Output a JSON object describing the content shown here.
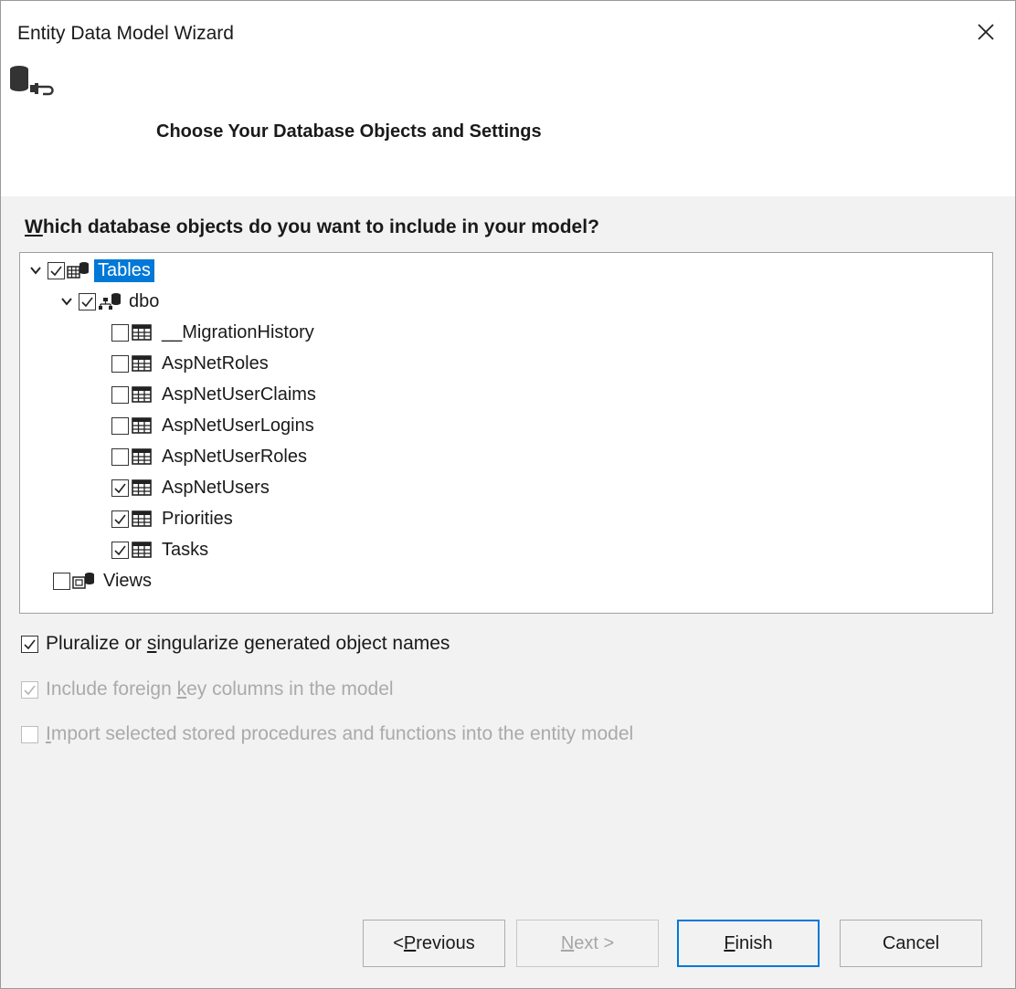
{
  "window": {
    "title": "Entity Data Model Wizard",
    "header": "Choose Your Database Objects and Settings"
  },
  "question": {
    "accel": "W",
    "rest": "hich database objects do you want to include in your model?"
  },
  "tree": {
    "root": {
      "label": "Tables",
      "checked": true,
      "expanded": true,
      "selected": true
    },
    "schema": {
      "label": "dbo",
      "checked": true,
      "expanded": true
    },
    "tables": [
      {
        "label": "__MigrationHistory",
        "checked": false
      },
      {
        "label": "AspNetRoles",
        "checked": false
      },
      {
        "label": "AspNetUserClaims",
        "checked": false
      },
      {
        "label": "AspNetUserLogins",
        "checked": false
      },
      {
        "label": "AspNetUserRoles",
        "checked": false
      },
      {
        "label": "AspNetUsers",
        "checked": true
      },
      {
        "label": "Priorities",
        "checked": true
      },
      {
        "label": "Tasks",
        "checked": true
      }
    ],
    "views": {
      "label": "Views",
      "checked": false
    }
  },
  "options": {
    "pluralize": {
      "pre": "Pluralize or ",
      "accel": "s",
      "post": "ingularize generated object names",
      "checked": true,
      "enabled": true
    },
    "foreign_keys": {
      "pre": "Include foreign ",
      "accel": "k",
      "post": "ey columns in the model",
      "checked": true,
      "enabled": false
    },
    "import_procs": {
      "pre": "",
      "accel": "I",
      "post": "mport selected stored procedures and functions into the entity model",
      "checked": false,
      "enabled": false
    }
  },
  "buttons": {
    "previous": {
      "pre": "< ",
      "accel": "P",
      "post": "revious",
      "enabled": true
    },
    "next": {
      "pre": "",
      "accel": "N",
      "post": "ext >",
      "enabled": false
    },
    "finish": {
      "pre": "",
      "accel": "F",
      "post": "inish",
      "enabled": true
    },
    "cancel": {
      "label": "Cancel",
      "enabled": true
    }
  },
  "icons": {
    "close": "close-icon",
    "header": "database-connect-icon",
    "tables": "tables-folder-icon",
    "schema": "schema-icon",
    "table": "table-icon",
    "views": "views-folder-icon"
  },
  "colors": {
    "selection": "#0078d7",
    "content_bg": "#f2f2f2",
    "disabled_text": "#aaaaaa"
  }
}
